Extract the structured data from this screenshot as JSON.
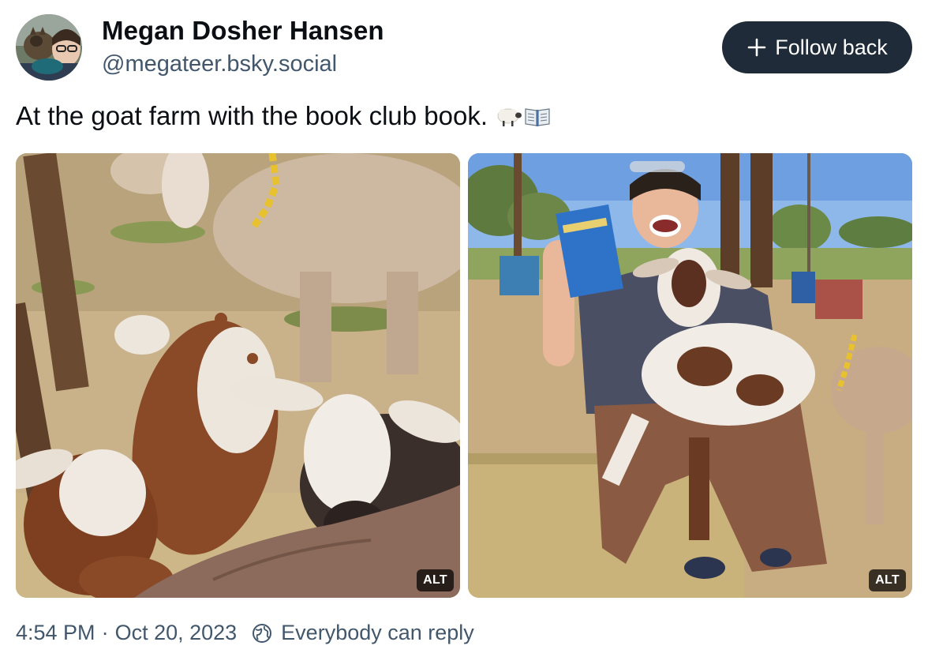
{
  "author": {
    "display_name": "Megan Dosher Hansen",
    "handle": "@megateer.bsky.social",
    "avatar_icon": "profile-photo-avatar"
  },
  "follow_button": {
    "icon": "plus-icon",
    "label": "Follow back",
    "background": "#1f2b38"
  },
  "post": {
    "text": "At the goat farm with the book club book.",
    "emoji": [
      "🐑",
      "📖"
    ]
  },
  "images": [
    {
      "alt_badge": "ALT"
    },
    {
      "alt_badge": "ALT"
    }
  ],
  "footer": {
    "time": "4:54 PM",
    "separator": "·",
    "date": "Oct 20, 2023",
    "reply_icon": "globe-reply-icon",
    "reply_setting": "Everybody can reply"
  },
  "colors": {
    "text_primary": "#0b0f14",
    "text_secondary": "#42576c",
    "button_bg": "#1f2b38"
  }
}
